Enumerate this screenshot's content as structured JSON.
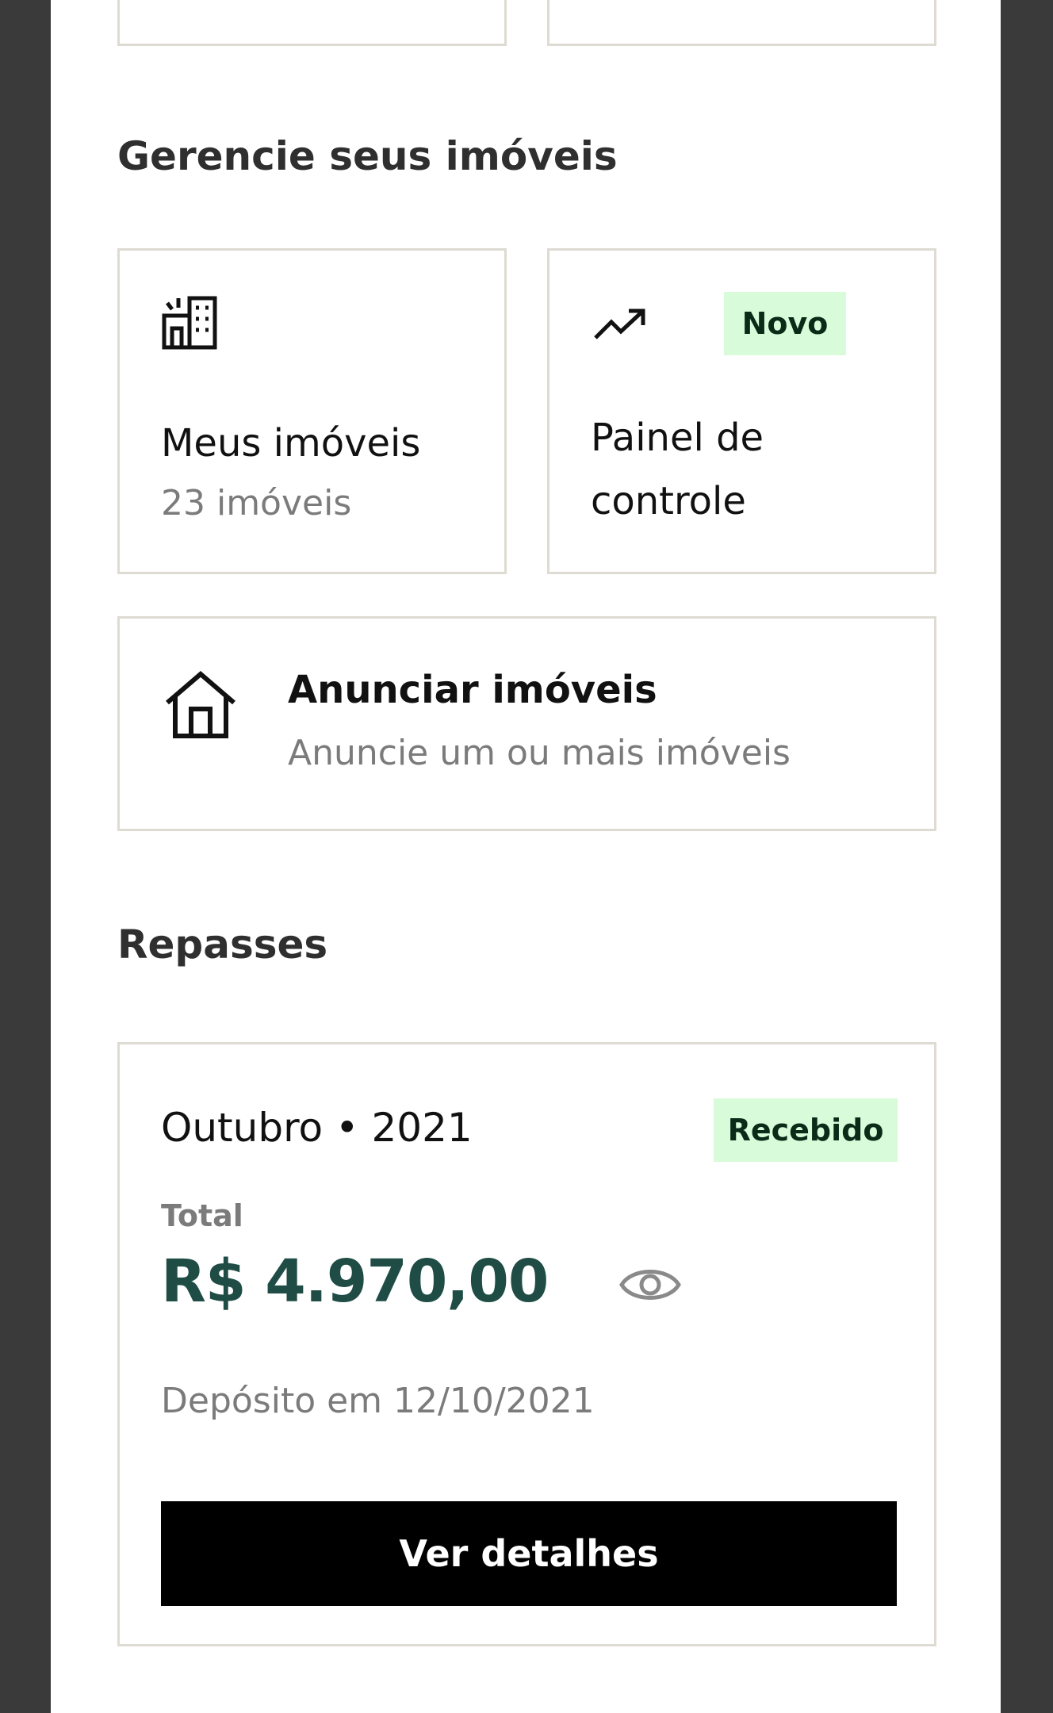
{
  "sections": {
    "manage_title": "Gerencie seus imóveis",
    "payouts_title": "Repasses"
  },
  "my_properties": {
    "title": "Meus imóveis",
    "count": "23 imóveis",
    "icon": "building-icon"
  },
  "dashboard": {
    "title_line1": "Painel de",
    "title_line2": "controle",
    "badge": "Novo",
    "icon": "trending-up-icon"
  },
  "advertise": {
    "title": "Anunciar imóveis",
    "subtitle": "Anuncie um ou mais imóveis",
    "icon": "house-icon"
  },
  "payout": {
    "month": "Outubro",
    "separator": "•",
    "year": "2021",
    "status": "Recebido",
    "total_label": "Total",
    "total_value": "R$ 4.970,00",
    "deposit": "Depósito em 12/10/2021",
    "details_button": "Ver detalhes",
    "visibility_icon": "eye-icon"
  },
  "colors": {
    "accent_green": "#1f4d45",
    "badge_bg": "#d8fcd9",
    "border": "#dedbd2"
  }
}
